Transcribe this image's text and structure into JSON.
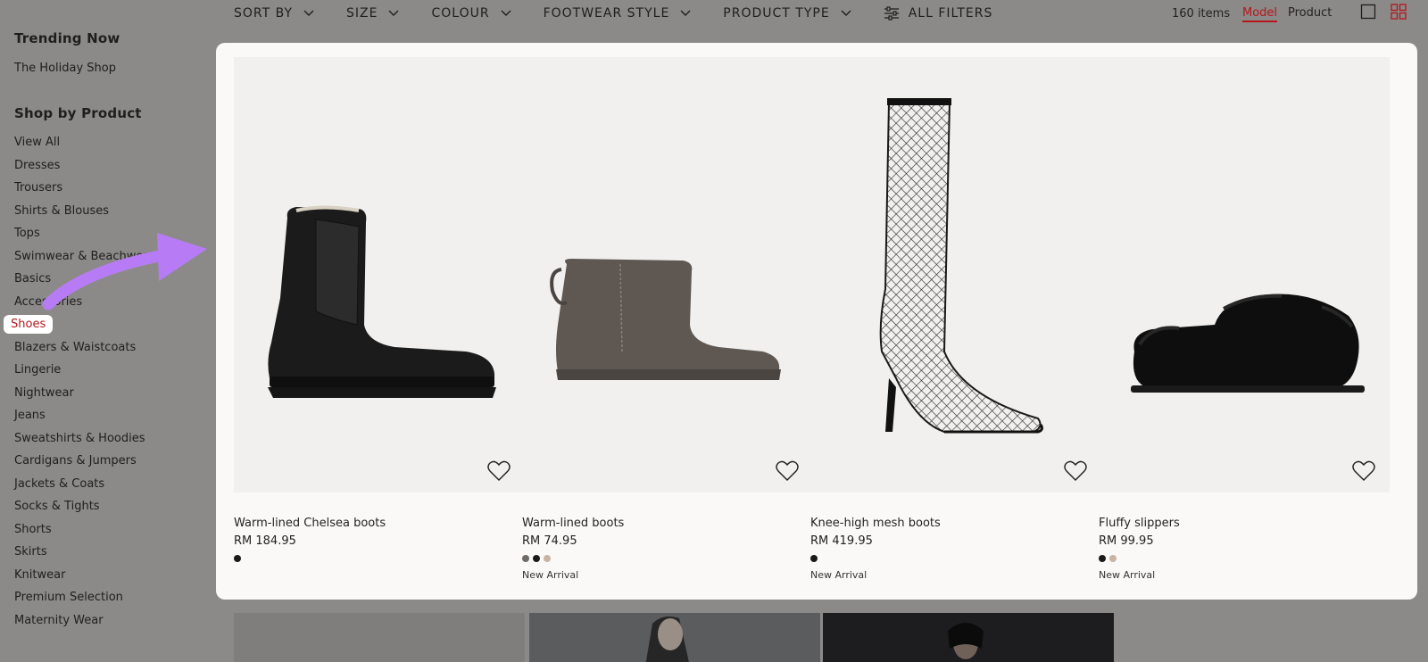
{
  "filters": [
    {
      "label": "SORT BY"
    },
    {
      "label": "SIZE"
    },
    {
      "label": "COLOUR"
    },
    {
      "label": "FOOTWEAR STYLE"
    },
    {
      "label": "PRODUCT TYPE"
    }
  ],
  "all_filters_label": "ALL FILTERS",
  "view": {
    "count": "160 items",
    "model_label": "Model",
    "product_label": "Product"
  },
  "sidebar": {
    "trending_heading": "Trending Now",
    "holiday_link": "The Holiday Shop",
    "shop_heading": "Shop by Product",
    "categories": [
      "View All",
      "Dresses",
      "Trousers",
      "Shirts & Blouses",
      "Tops",
      "Swimwear & Beachwear",
      "Basics",
      "Accessories",
      "Shoes",
      "Blazers & Waistcoats",
      "Lingerie",
      "Nightwear",
      "Jeans",
      "Sweatshirts & Hoodies",
      "Cardigans & Jumpers",
      "Jackets & Coats",
      "Socks & Tights",
      "Shorts",
      "Skirts",
      "Knitwear",
      "Premium Selection",
      "Maternity Wear"
    ],
    "active_index": 8
  },
  "products": [
    {
      "name": "Warm-lined Chelsea boots",
      "price": "RM 184.95",
      "swatches": [
        "#1a1a1a"
      ],
      "tag": ""
    },
    {
      "name": "Warm-lined boots",
      "price": "RM 74.95",
      "swatches": [
        "#6e6a66",
        "#1a1a1a",
        "#c9b3a3"
      ],
      "tag": "New Arrival"
    },
    {
      "name": "Knee-high mesh boots",
      "price": "RM 419.95",
      "swatches": [
        "#1a1a1a"
      ],
      "tag": "New Arrival"
    },
    {
      "name": "Fluffy slippers",
      "price": "RM 99.95",
      "swatches": [
        "#1a1a1a",
        "#c9b3a3"
      ],
      "tag": "New Arrival"
    }
  ],
  "colors": {
    "accent": "#b4161b",
    "arrow": "#b77cf5",
    "overlay": "#8b8a88"
  }
}
